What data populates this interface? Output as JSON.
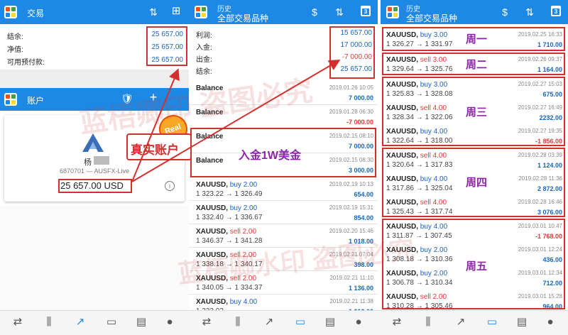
{
  "panel1": {
    "title": "交易",
    "balance_label": "结余:",
    "balance_value": "25 657.00",
    "equity_label": "净值:",
    "equity_value": "25 657.00",
    "free_margin_label": "可用预付款:",
    "free_margin_value": "25 657.00"
  },
  "accounts": {
    "title": "账户",
    "user_name": "杨",
    "account_info": "6870701 — AUSFX-Live",
    "balance": "25 657.00 USD",
    "badge": "Real",
    "annotation": "真实账户"
  },
  "panel2": {
    "title": "历史",
    "subtitle": "全部交易品种",
    "summary": [
      {
        "label": "利润:",
        "value": "15 657.00",
        "neg": false
      },
      {
        "label": "入金:",
        "value": "17 000.00",
        "neg": false
      },
      {
        "label": "出金:",
        "value": "-7 000.00",
        "neg": true
      },
      {
        "label": "结余:",
        "value": "25 657.00",
        "neg": false
      }
    ],
    "deposit_annotation": "入金1W美金",
    "rows": [
      {
        "symbol": "Balance",
        "side": "",
        "lot": "",
        "prices": "",
        "date": "2019.01.26 10:05",
        "amount": "7 000.00",
        "neg": false
      },
      {
        "symbol": "Balance",
        "side": "",
        "lot": "",
        "prices": "",
        "date": "2019.01.28 06:30",
        "amount": "-7 000.00",
        "neg": true
      },
      {
        "symbol": "Balance",
        "side": "",
        "lot": "",
        "prices": "",
        "date": "2019.02.15 08:10",
        "amount": "7 000.00",
        "neg": false
      },
      {
        "symbol": "Balance",
        "side": "",
        "lot": "",
        "prices": "",
        "date": "2019.02.15 08:30",
        "amount": "3 000.00",
        "neg": false
      },
      {
        "symbol": "XAUUSD, ",
        "side": "buy",
        "lot": " 2.00",
        "prices": "1 323.22 → 1 326.49",
        "date": "2019.02.19 10:13",
        "amount": "654.00",
        "neg": false
      },
      {
        "symbol": "XAUUSD, ",
        "side": "buy",
        "lot": " 2.00",
        "prices": "1 332.40 → 1 336.67",
        "date": "2019.02.19 15:31",
        "amount": "854.00",
        "neg": false
      },
      {
        "symbol": "XAUUSD, ",
        "side": "sell",
        "lot": " 2.00",
        "prices": "1 346.37 → 1 341.28",
        "date": "2019.02.20 15:46",
        "amount": "1 018.00",
        "neg": false
      },
      {
        "symbol": "XAUUSD, ",
        "side": "sell",
        "lot": " 2.00",
        "prices": "1 338.18 → 1 340.17",
        "date": "2019.02.21 07:04",
        "amount": "398.00",
        "neg": false
      },
      {
        "symbol": "XAUUSD, ",
        "side": "sell",
        "lot": " 2.00",
        "prices": "1 340.05 → 1 334.37",
        "date": "2019.02.21 11:10",
        "amount": "1 136.00",
        "neg": false
      },
      {
        "symbol": "XAUUSD, ",
        "side": "buy",
        "lot": " 4.00",
        "prices": "1 333.03 → ",
        "date": "2019.02.21 11:38",
        "amount": "1 212.00",
        "neg": false
      }
    ]
  },
  "panel3": {
    "title": "历史",
    "subtitle": "全部交易品种",
    "rows": [
      {
        "symbol": "XAUUSD, ",
        "side": "buy",
        "lot": " 3.00",
        "prices": "1 326.27 → 1 331.97",
        "date": "2019.02.25 16:33",
        "amount": "1 710.00",
        "neg": false
      },
      {
        "symbol": "XAUUSD, ",
        "side": "sell",
        "lot": " 3.00",
        "prices": "1 329.64 → 1 325.76",
        "date": "2019.02.26 09:37",
        "amount": "1 164.00",
        "neg": false
      },
      {
        "symbol": "XAUUSD, ",
        "side": "buy",
        "lot": " 3.00",
        "prices": "1 325.83 → 1 328.08",
        "date": "2019.02.27 15:03",
        "amount": "675.00",
        "neg": false
      },
      {
        "symbol": "XAUUSD, ",
        "side": "sell",
        "lot": " 4.00",
        "prices": "1 328.34 → 1 322.06",
        "date": "2019.02.27 16:49",
        "amount": "2232.00",
        "neg": false
      },
      {
        "symbol": "XAUUSD, ",
        "side": "buy",
        "lot": " 4.00",
        "prices": "1 322.64 → 1 318.00",
        "date": "2019.02.27 19:35",
        "amount": "-1 856.00",
        "neg": true
      },
      {
        "symbol": "XAUUSD, ",
        "side": "sell",
        "lot": " 4.00",
        "prices": "1 320.64 → 1 317.83",
        "date": "2019.02.28 03:39",
        "amount": "1 124.00",
        "neg": false
      },
      {
        "symbol": "XAUUSD, ",
        "side": "buy",
        "lot": " 4.00",
        "prices": "1 317.86 → 1 325.04",
        "date": "2019.02.28 11:36",
        "amount": "2 872.00",
        "neg": false
      },
      {
        "symbol": "XAUUSD, ",
        "side": "sell",
        "lot": " 4.00",
        "prices": "1 325.43 → 1 317.74",
        "date": "2019.02.28 16:46",
        "amount": "3 076.00",
        "neg": false
      },
      {
        "symbol": "XAUUSD, ",
        "side": "buy",
        "lot": " 4.00",
        "prices": "1 311.87 → 1 307.45",
        "date": "2019.03.01 10:47",
        "amount": "-1 768.00",
        "neg": true
      },
      {
        "symbol": "XAUUSD, ",
        "side": "buy",
        "lot": " 2.00",
        "prices": "1 308.18 → 1 310.36",
        "date": "2019.03.01 12:24",
        "amount": "436.00",
        "neg": false
      },
      {
        "symbol": "XAUUSD, ",
        "side": "buy",
        "lot": " 2.00",
        "prices": "1 306.78 → 1 310.34",
        "date": "2019.03.01 12:34",
        "amount": "712.00",
        "neg": false
      },
      {
        "symbol": "XAUUSD, ",
        "side": "sell",
        "lot": " 2.00",
        "prices": "1 310.28 → 1 305.46",
        "date": "2019.03.01 15:28",
        "amount": "964.00",
        "neg": false
      }
    ],
    "days": [
      "周一",
      "周二",
      "周三",
      "周四",
      "周五"
    ]
  },
  "watermark": [
    "蓝梧卿印 盗图必究",
    "蓝梧卿水印 盗图必究"
  ],
  "colors": {
    "accent": "#1e88e5",
    "annotation": "#d32f2f",
    "day_label": "#8e24aa"
  }
}
